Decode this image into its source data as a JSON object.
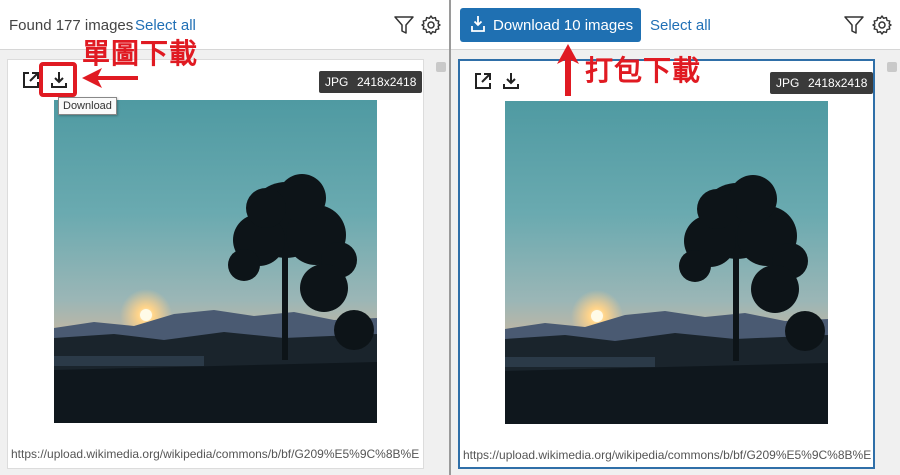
{
  "left": {
    "found_text": "Found 177 images",
    "select_all": "Select all",
    "card": {
      "format_badge": "JPG",
      "size_badge": "2418x2418",
      "url": "https://upload.wikimedia.org/wikipedia/commons/b/bf/G209%E5%9C%8B%E"
    },
    "tooltip": "Download",
    "annotation": "單圖下載"
  },
  "right": {
    "download_button": "Download 10 images",
    "select_all": "Select all",
    "card": {
      "format_badge": "JPG",
      "size_badge": "2418x2418",
      "url": "https://upload.wikimedia.org/wikipedia/commons/b/bf/G209%E5%9C%8B%E"
    },
    "annotation": "打包下載"
  },
  "colors": {
    "accent": "#1f70b2",
    "annotation": "#e01a22",
    "selected_border": "#2f6fa8"
  },
  "icons": [
    "open-external-icon",
    "download-icon",
    "filter-icon",
    "gear-icon"
  ]
}
